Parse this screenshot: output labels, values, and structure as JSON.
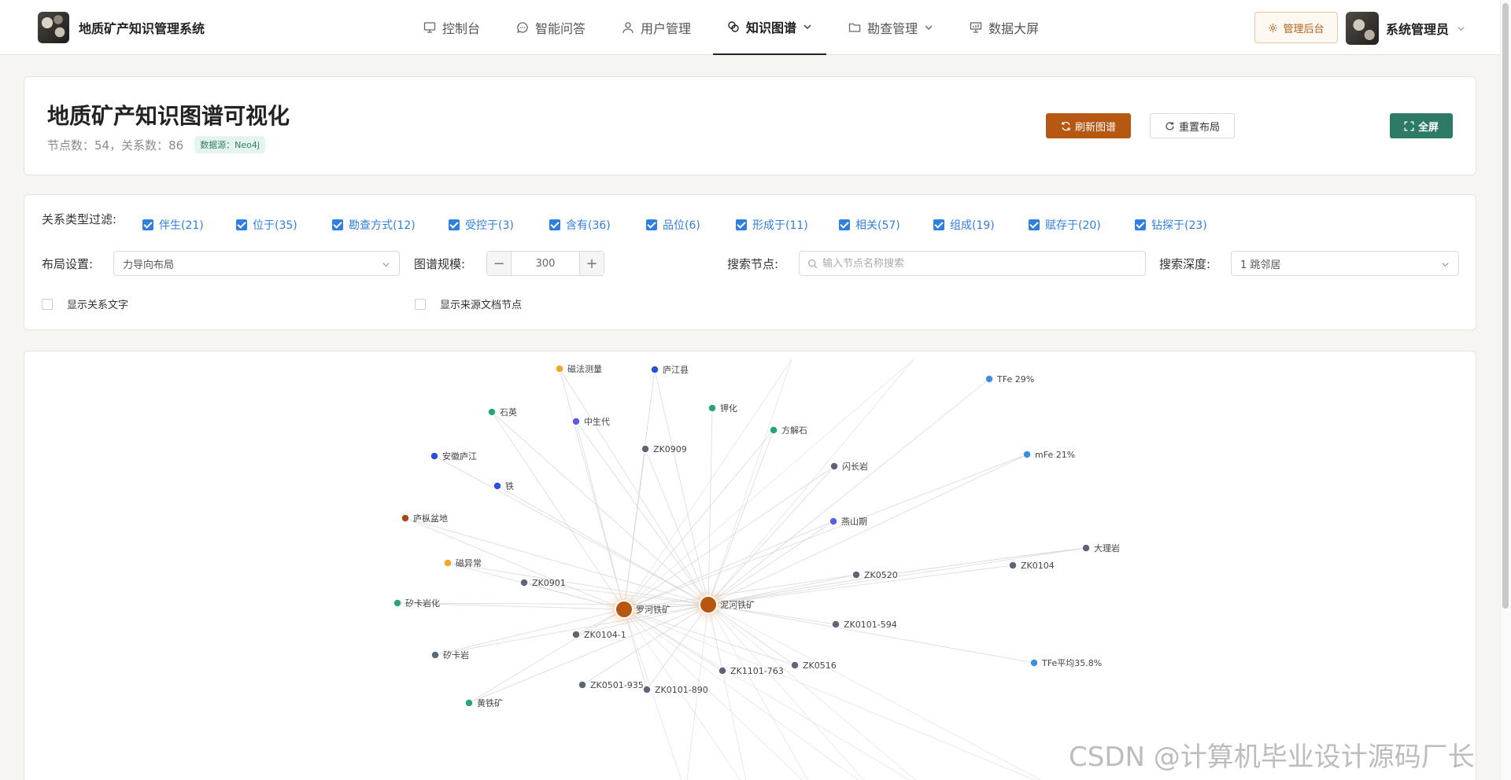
{
  "app": {
    "title": "地质矿产知识管理系统"
  },
  "nav": {
    "items": [
      {
        "label": "控制台",
        "icon": "monitor-icon"
      },
      {
        "label": "智能问答",
        "icon": "chat-icon"
      },
      {
        "label": "用户管理",
        "icon": "user-icon"
      },
      {
        "label": "知识图谱",
        "icon": "graph-icon",
        "active": true,
        "dropdown": true
      },
      {
        "label": "勘查管理",
        "icon": "folder-icon",
        "dropdown": true
      },
      {
        "label": "数据大屏",
        "icon": "screen-icon"
      }
    ],
    "admin_label": "管理后台",
    "user_name": "系统管理员"
  },
  "header": {
    "title": "地质矿产知识图谱可视化",
    "stats": "节点数：54，关系数：86",
    "badge": "数据源：Neo4j",
    "refresh_label": "刷新图谱",
    "reset_label": "重置布局",
    "fullscreen_label": "全屏"
  },
  "filters": {
    "relation_label": "关系类型过滤:",
    "relations": [
      {
        "label": "伴生(21)",
        "checked": true
      },
      {
        "label": "位于(35)",
        "checked": true
      },
      {
        "label": "勘查方式(12)",
        "checked": true
      },
      {
        "label": "受控于(3)",
        "checked": true
      },
      {
        "label": "含有(36)",
        "checked": true
      },
      {
        "label": "品位(6)",
        "checked": true
      },
      {
        "label": "形成于(11)",
        "checked": true
      },
      {
        "label": "相关(57)",
        "checked": true
      },
      {
        "label": "组成(19)",
        "checked": true
      },
      {
        "label": "赋存于(20)",
        "checked": true
      },
      {
        "label": "钻探于(23)",
        "checked": true
      }
    ],
    "layout_label": "布局设置:",
    "layout_value": "力导向布局",
    "scale_label": "图谱规模:",
    "scale_value": "300",
    "search_label": "搜索节点:",
    "search_placeholder": "输入节点名称搜索",
    "depth_label": "搜索深度:",
    "depth_value": "1 跳邻居",
    "show_relation_text": "显示关系文字",
    "show_source_nodes": "显示来源文档节点"
  },
  "colors": {
    "accent": "#b65811",
    "fullscreen": "#2d7a66",
    "checkbox": "#2f7fe0"
  },
  "graph": {
    "hubs": [
      {
        "label": "罗河铁矿",
        "color": "#b8560f"
      },
      {
        "label": "泥河铁矿",
        "color": "#b8560f"
      }
    ],
    "nodes": [
      {
        "label": "磁法测量",
        "color": "#f5a623"
      },
      {
        "label": "庐江县",
        "color": "#2a50d8"
      },
      {
        "label": "TFe 29%",
        "color": "#3b8fe0"
      },
      {
        "label": "石英",
        "color": "#27a37f"
      },
      {
        "label": "中生代",
        "color": "#5a5ee0"
      },
      {
        "label": "钾化",
        "color": "#27a37f"
      },
      {
        "label": "方解石",
        "color": "#27a37f"
      },
      {
        "label": "ZK0909",
        "color": "#5d6676"
      },
      {
        "label": "安徽庐江",
        "color": "#2a50d8"
      },
      {
        "label": "闪长岩",
        "color": "#5d6676"
      },
      {
        "label": "mFe 21%",
        "color": "#3b8fe0"
      },
      {
        "label": "铁",
        "color": "#2a50d8"
      },
      {
        "label": "燕山期",
        "color": "#5a5ee0"
      },
      {
        "label": "庐枞盆地",
        "color": "#a8471a"
      },
      {
        "label": "大理岩",
        "color": "#5d6676"
      },
      {
        "label": "磁异常",
        "color": "#f5a623"
      },
      {
        "label": "ZK0520",
        "color": "#5d6676"
      },
      {
        "label": "ZK0104",
        "color": "#5d6676"
      },
      {
        "label": "ZK0901",
        "color": "#5d6676"
      },
      {
        "label": "矽卡岩化",
        "color": "#27a37f"
      },
      {
        "label": "ZK0101-594",
        "color": "#5d6676"
      },
      {
        "label": "ZK0104-1",
        "color": "#5d6676"
      },
      {
        "label": "矽卡岩",
        "color": "#5d6676"
      },
      {
        "label": "TFe平均35.8%",
        "color": "#3b8fe0"
      },
      {
        "label": "ZK1101-763",
        "color": "#5d6676"
      },
      {
        "label": "ZK0516",
        "color": "#5d6676"
      },
      {
        "label": "ZK0501-935",
        "color": "#5d6676"
      },
      {
        "label": "ZK0101-890",
        "color": "#5d6676"
      },
      {
        "label": "黄铁矿",
        "color": "#27a37f"
      }
    ]
  },
  "watermark": "CSDN @计算机毕业设计源码厂长"
}
